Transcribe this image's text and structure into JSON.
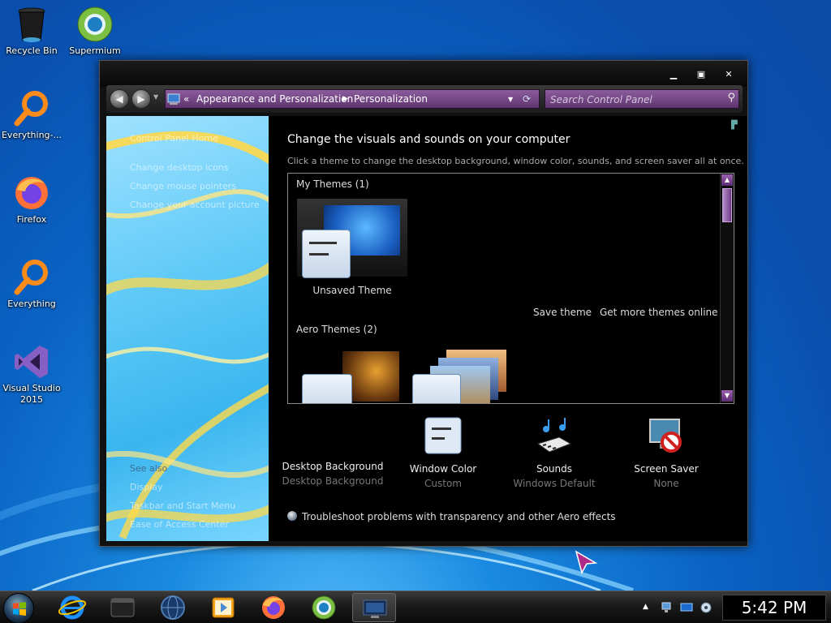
{
  "desktop": {
    "icons": [
      {
        "label": "Recycle Bin",
        "icon": "recycle-bin-icon"
      },
      {
        "label": "Supermium",
        "icon": "supermium-icon"
      },
      {
        "label": "Everything-...",
        "icon": "everything-search-icon"
      },
      {
        "label": "Firefox",
        "icon": "firefox-icon"
      },
      {
        "label": "Everything",
        "icon": "everything-search-icon"
      },
      {
        "label": "Visual Studio 2015",
        "icon": "visual-studio-icon"
      }
    ]
  },
  "window": {
    "address": {
      "crumb1": "Appearance and Personalization",
      "crumb2": "Personalization",
      "search_placeholder": "Search Control Panel"
    },
    "left_pane": {
      "home": "Control Panel Home",
      "links": [
        "Change desktop icons",
        "Change mouse pointers",
        "Change your account picture"
      ],
      "see_also_label": "See also",
      "see_also": [
        "Display",
        "Taskbar and Start Menu",
        "Ease of Access Center"
      ]
    },
    "content": {
      "title": "Change the visuals and sounds on your computer",
      "subtitle": "Click a theme to change the desktop background, window color, sounds, and screen saver all at once.",
      "my_themes_label": "My Themes (1)",
      "unsaved_theme_label": "Unsaved Theme",
      "save_theme": "Save theme",
      "get_more_themes": "Get more themes online",
      "aero_themes_label": "Aero Themes (2)",
      "tools": [
        {
          "label": "Desktop Background",
          "value": "Desktop Background",
          "icon": "desktop-background-icon"
        },
        {
          "label": "Window Color",
          "value": "Custom",
          "icon": "window-color-icon"
        },
        {
          "label": "Sounds",
          "value": "Windows Default",
          "icon": "sounds-icon"
        },
        {
          "label": "Screen Saver",
          "value": "None",
          "icon": "screen-saver-icon"
        }
      ],
      "troubleshoot": "Troubleshoot problems with transparency and other Aero effects"
    }
  },
  "taskbar": {
    "clock": "5:42 PM",
    "pinned": [
      "internet-explorer-icon",
      "terminal-icon",
      "globe-icon",
      "media-player-icon",
      "firefox-icon",
      "supermium-icon",
      "personalization-icon"
    ]
  }
}
